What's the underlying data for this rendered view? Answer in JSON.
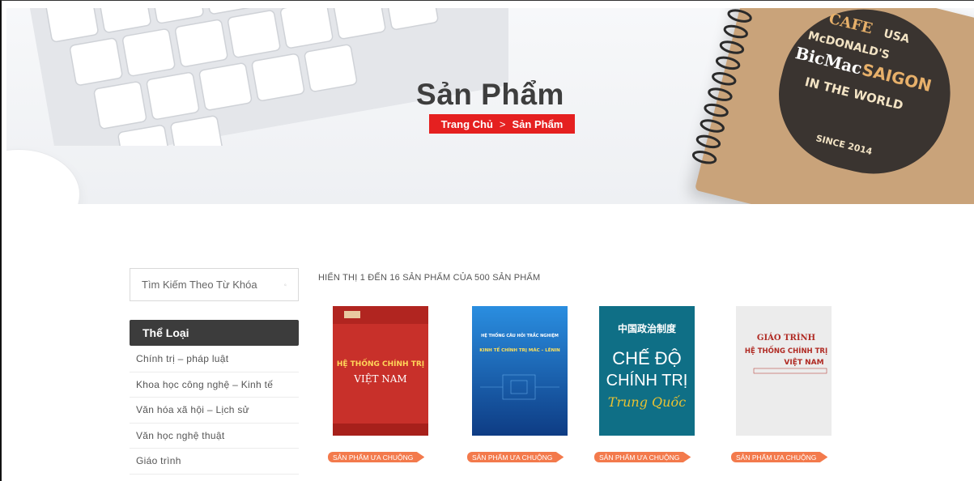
{
  "hero": {
    "title": "Sản Phẩm",
    "breadcrumb": {
      "home": "Trang Chủ",
      "separator": ">",
      "current": "Sản Phẩm"
    },
    "notebook_art_lines": [
      "CAFE",
      "USA",
      "McDONALD'S",
      "BicMac",
      "SAIGON",
      "IN THE WORLD",
      "SINCE 2014"
    ]
  },
  "sidebar": {
    "search": {
      "placeholder": "Tìm Kiếm Theo Từ Khóa"
    },
    "category_heading": "Thể Loại",
    "categories": [
      "Chính trị – pháp luật",
      "Khoa học công nghệ – Kinh tế",
      "Văn hóa xã hội – Lịch sử",
      "Văn học nghệ thuật",
      "Giáo trình"
    ]
  },
  "listing": {
    "result_count": "HIỂN THỊ 1 ĐẾN 16 SẢN PHẨM CỦA 500 SẢN PHẨM",
    "products": [
      {
        "badge": "SẢN PHẨM ƯA CHUỘNG",
        "cover_line1": "HỆ THỐNG CHÍNH TRỊ",
        "cover_line2": "VIỆT NAM",
        "cover_color": "#c8302a"
      },
      {
        "badge": "SẢN PHẨM ƯA CHUỘNG",
        "cover_line1": "HỆ THỐNG CÂU HỎI TRẮC NGHIỆM",
        "cover_line2": "KINH TẾ CHÍNH TRỊ MÁC – LÊNIN",
        "cover_color": "#1c6fc0"
      },
      {
        "badge": "SẢN PHẨM ƯA CHUỘNG",
        "cover_line0": "中国政治制度",
        "cover_line1": "CHẾ ĐỘ",
        "cover_line2": "CHÍNH TRỊ",
        "cover_line3": "Trung Quốc",
        "cover_color": "#0f6f86"
      },
      {
        "badge": "SẢN PHẨM ƯA CHUỘNG",
        "cover_line0": "GIÁO TRÌNH",
        "cover_line1": "HỆ THỐNG CHÍNH TRỊ",
        "cover_line2": "VIỆT NAM",
        "cover_color": "#ececec"
      }
    ]
  },
  "colors": {
    "accent_red": "#e52020",
    "badge_orange": "#f37a4c",
    "dark_heading": "#3c3c3c"
  }
}
